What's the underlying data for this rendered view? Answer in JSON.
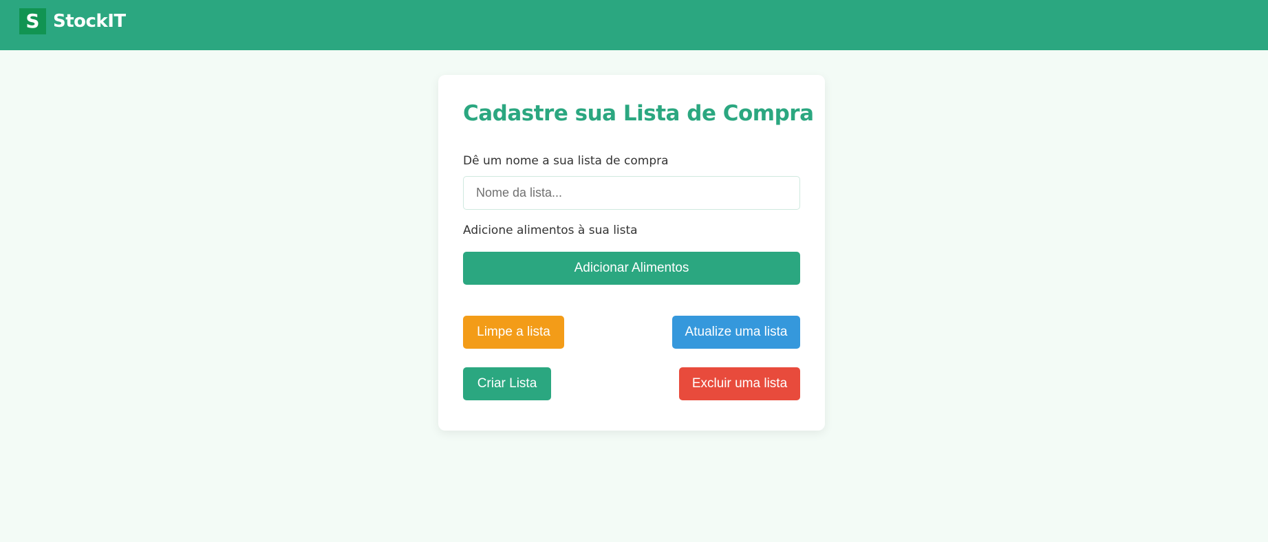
{
  "header": {
    "logo_letter": "S",
    "app_name": "StockIT",
    "bar_color": "#2ba780",
    "logo_color": "#119452"
  },
  "form": {
    "title": "Cadastre sua Lista de Compra",
    "name_label": "Dê um nome a sua lista de compra",
    "name_input": {
      "value": "",
      "placeholder": "Nome da lista..."
    },
    "foods_label": "Adicione alimentos à sua lista",
    "add_foods_button": "Adicionar Alimentos",
    "clear_button": "Limpe a lista",
    "update_button": "Atualize uma lista",
    "create_button": "Criar Lista",
    "delete_button": "Excluir uma lista"
  },
  "colors": {
    "primary": "#2ba780",
    "warning": "#f39c18",
    "info": "#3598dc",
    "danger": "#e84b3c",
    "page_background": "#f3fbf6"
  }
}
